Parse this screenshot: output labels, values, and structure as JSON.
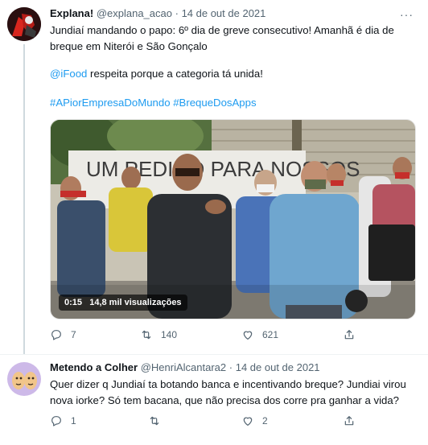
{
  "tweet1": {
    "display_name": "Explana!",
    "handle": "@explana_acao",
    "separator": "·",
    "date": "14 de out de 2021",
    "more": "···",
    "text_line1": "Jundiaí mandando o papo: 6º dia de greve consecutivo! Amanhã é dia de",
    "text_line2": "breque em Niterói e São Gonçalo",
    "mention": "@iFood",
    "text_line3_rest": " respeita porque a categoria tá unida!",
    "hashtags": "#APiorEmpresaDoMundo #BrequeDosApps",
    "banner_text": "UM PEDIDO PARA NOSSOS",
    "video": {
      "time": "0:15",
      "views": "14,8 mil visualizações"
    },
    "actions": {
      "reply_count": "7",
      "retweet_count": "140",
      "like_count": "621",
      "share_count": ""
    }
  },
  "tweet2": {
    "display_name": "Metendo a Colher",
    "handle": "@HenriAlcantara2",
    "separator": "·",
    "date": "14 de out de 2021",
    "text_line1": "Quer dizer q Jundiaí ta botando banca e incentivando breque? Jundiai virou",
    "text_line2": "nova iorke? Só tem bacana, que não precisa dos corre pra ganhar a vida?",
    "actions": {
      "reply_count": "1",
      "retweet_count": "",
      "like_count": "2",
      "share_count": ""
    }
  },
  "colors": {
    "link": "#1d9bf0",
    "text": "#0f1419",
    "muted": "#536471"
  }
}
